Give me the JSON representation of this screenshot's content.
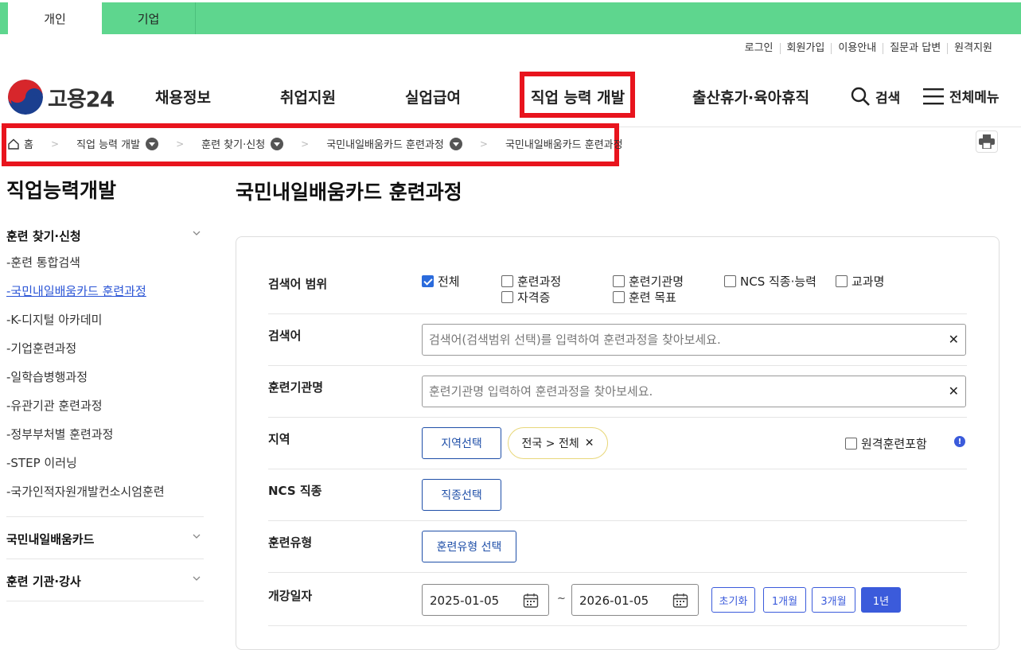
{
  "tabs": [
    "개인",
    "기업"
  ],
  "util_links": [
    "로그인",
    "회원가입",
    "이용안내",
    "질문과 답변",
    "원격지원"
  ],
  "logo_text": "고용24",
  "gnb": [
    "채용정보",
    "취업지원",
    "실업급여",
    "직업 능력 개발",
    "출산휴가·육아휴직"
  ],
  "search_label": "검색",
  "menu_label": "전체메뉴",
  "breadcrumb": [
    "홈",
    "직업 능력 개발",
    "훈련 찾기·신청",
    "국민내일배움카드 훈련과정",
    "국민내일배움카드 훈련과정"
  ],
  "sidebar": {
    "title": "직업능력개발",
    "section1": "훈련 찾기·신청",
    "items": [
      "-훈련 통합검색",
      "-국민내일배움카드 훈련과정",
      "-K-디지털 아카데미",
      "-기업훈련과정",
      "-일학습병행과정",
      "-유관기관 훈련과정",
      "-정부부처별 훈련과정",
      "-STEP 이러닝",
      "-국가인적자원개발컨소시엄훈련"
    ],
    "section2": "국민내일배움카드",
    "section3": "훈련 기관·강사"
  },
  "main": {
    "title": "국민내일배움카드 훈련과정",
    "scope_label": "검색어 범위",
    "scope_options": [
      "전체",
      "훈련과정",
      "훈련기관명",
      "NCS 직종·능력",
      "교과명",
      "자격증",
      "훈련 목표"
    ],
    "keyword_label": "검색어",
    "keyword_placeholder": "검색어(검색범위 선택)를 입력하여 훈련과정을 찾아보세요.",
    "inst_label": "훈련기관명",
    "inst_placeholder": "훈련기관명 입력하여 훈련과정을 찾아보세요.",
    "region_label": "지역",
    "region_btn": "지역선택",
    "region_chip": "전국 > 전체",
    "remote_label": "원격훈련포함",
    "ncs_label": "NCS 직종",
    "ncs_btn": "직종선택",
    "type_label": "훈련유형",
    "type_btn": "훈련유형 선택",
    "date_label": "개강일자",
    "date_from": "2025-01-05",
    "date_to": "2026-01-05",
    "range_btns": [
      "초기화",
      "1개월",
      "3개월",
      "1년"
    ]
  }
}
